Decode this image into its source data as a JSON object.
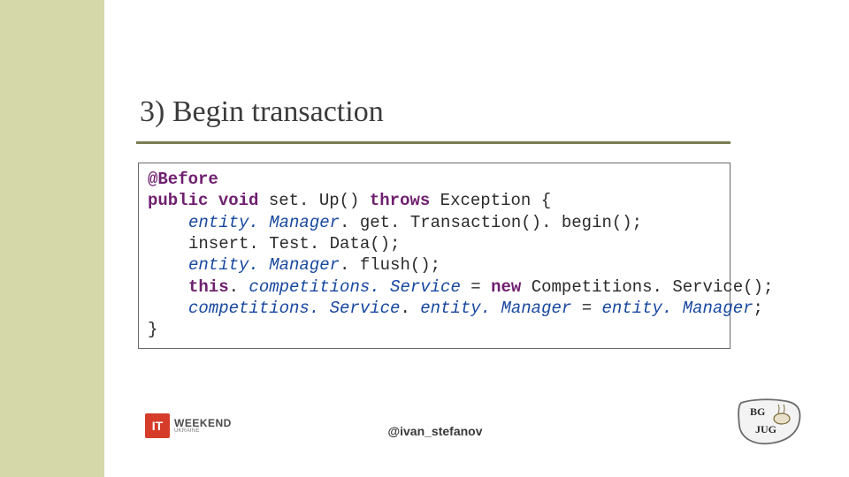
{
  "title": "3) Begin transaction",
  "code": {
    "l1_kw": "@Before",
    "l2_kw1": "public",
    "l2_kw2": "void",
    "l2_mid": " set. Up() ",
    "l2_kw3": "throws",
    "l2_end": " Exception {",
    "l3_a": "entity. Manager",
    "l3_b": ". get. Transaction(). begin();",
    "l4": "insert. Test. Data();",
    "l5_a": "entity. Manager",
    "l5_b": ". flush();",
    "l6_a": "this",
    "l6_b": ". ",
    "l6_c": "competitions. Service",
    "l6_d": " = ",
    "l6_e": "new",
    "l6_f": " Competitions. Service();",
    "l7_a": "competitions. Service",
    "l7_b": ". ",
    "l7_c": "entity. Manager",
    "l7_d": " = ",
    "l7_e": "entity. Manager",
    "l7_f": ";",
    "l8": "}"
  },
  "footer": {
    "handle": "@ivan_stefanov"
  },
  "logos": {
    "it_badge": "IT",
    "it_text": "WEEKEND",
    "it_sub": "UKRAINE",
    "bg": "BG JUG"
  }
}
